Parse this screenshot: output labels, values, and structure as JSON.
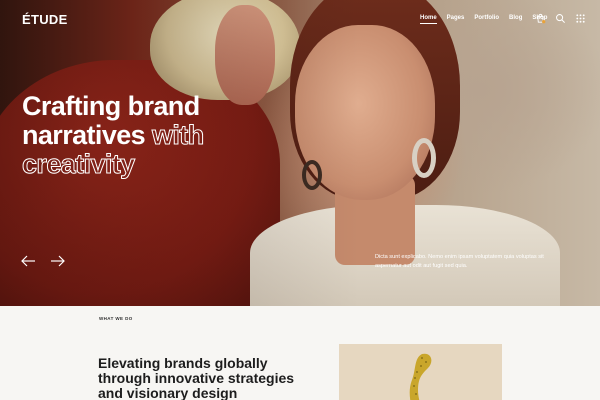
{
  "brand": {
    "logo": "ÉTUDE"
  },
  "nav": {
    "items": [
      {
        "label": "Home",
        "active": true
      },
      {
        "label": "Pages"
      },
      {
        "label": "Portfolio"
      },
      {
        "label": "Blog"
      },
      {
        "label": "Shop"
      }
    ],
    "icons": [
      "cart-icon",
      "search-icon",
      "grid-menu-icon"
    ]
  },
  "hero": {
    "headline_line1": "Crafting brand",
    "headline_line2_solid": "narratives",
    "headline_line2_outline": "with",
    "headline_line3_outline": "creativity",
    "description": "Dicta sunt explicabo. Nemo enim ipsam voluptatem quia voluptas sit aspernatur aut odit aut fugit sed quia."
  },
  "section": {
    "eyebrow": "WHAT WE DO",
    "title": "Elevating brands globally through innovative strategies and visionary design"
  },
  "colors": {
    "accent_white": "#ffffff",
    "section_bg": "#f7f6f3",
    "image_bg": "#e6d7c0",
    "sculpture": "#c9a62b"
  }
}
